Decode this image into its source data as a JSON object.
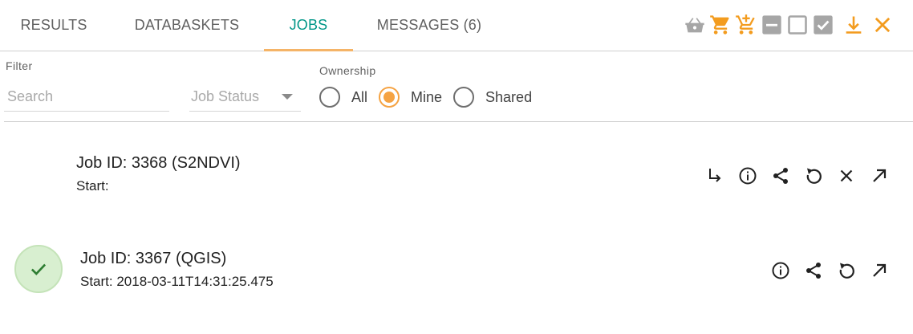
{
  "tabs": [
    {
      "label": "RESULTS",
      "active": false
    },
    {
      "label": "DATABASKETS",
      "active": false
    },
    {
      "label": "JOBS",
      "active": true
    },
    {
      "label": "MESSAGES (6)",
      "active": false
    }
  ],
  "toolbar": {
    "icons": [
      "basket-icon",
      "cart-icon",
      "cart-add-icon",
      "deselect-all-icon",
      "checkbox-empty-icon",
      "checkbox-checked-icon",
      "download-icon",
      "close-icon"
    ],
    "accent_color": "#f39c1f",
    "muted_color": "#a6a6a6"
  },
  "filter": {
    "label": "Filter",
    "search_placeholder": "Search",
    "job_status_placeholder": "Job Status"
  },
  "ownership": {
    "label": "Ownership",
    "options": [
      "All",
      "Mine",
      "Shared"
    ],
    "selected": "Mine"
  },
  "jobs": [
    {
      "title": "Job ID: 3368 (S2NDVI)",
      "start": "Start:",
      "status": "none",
      "actions": [
        "subjob-arrow-icon",
        "info-icon",
        "share-icon",
        "retry-icon",
        "cancel-icon",
        "open-external-icon"
      ]
    },
    {
      "title": "Job ID: 3367 (QGIS)",
      "start": "Start: 2018-03-11T14:31:25.475",
      "status": "succeeded",
      "actions": [
        "info-icon",
        "share-icon",
        "retry-icon",
        "open-external-icon"
      ]
    }
  ],
  "colors": {
    "active_tab": "#009688",
    "tab_indicator": "#f5b467",
    "radio_selected": "#f5a343",
    "success_fill": "#d8efd0",
    "success_check": "#2e7d32"
  }
}
